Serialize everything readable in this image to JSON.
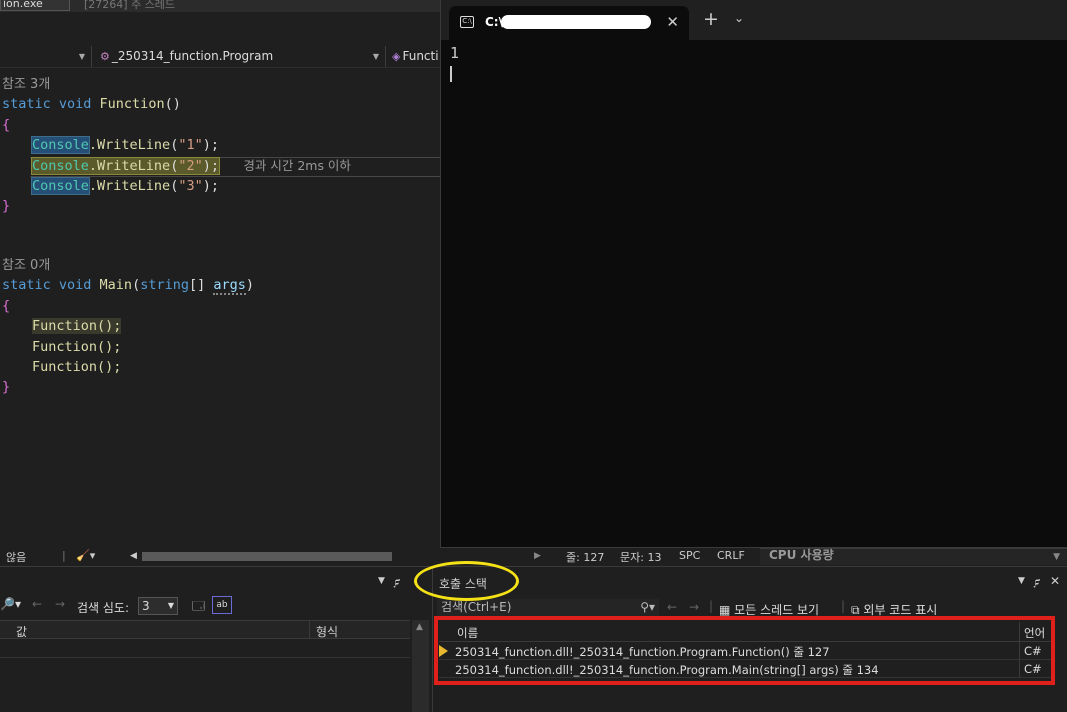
{
  "debug_bar": {
    "process_fragment": "ion.exe",
    "thread_fragment": "[27264] 주 스레드"
  },
  "nav": {
    "class_dropdown": "_250314_function.Program",
    "member_dropdown": "Functi"
  },
  "editor": {
    "ref_count_3": "참조 3개",
    "ref_count_0": "참조 0개",
    "elapsed_tip": "경과 시간 2ms 이하",
    "fn_decl": {
      "kw": "static void",
      "name": "Function",
      "params": "()"
    },
    "main_decl": {
      "kw": "static void",
      "name": "Main",
      "type": "string",
      "args": "args"
    },
    "writeline_calls": [
      {
        "cls": "Console",
        "method": ".WriteLine",
        "arg": "\"1\""
      },
      {
        "cls": "Console",
        "method": ".WriteLine",
        "arg": "\"2\""
      },
      {
        "cls": "Console",
        "method": ".WriteLine",
        "arg": "\"3\""
      }
    ],
    "function_calls": [
      "Function();",
      "Function();",
      "Function();"
    ]
  },
  "console": {
    "tab_title": "C:\\",
    "output_line": "1",
    "plus": "+",
    "chevron": "⌄",
    "close": "✕"
  },
  "status": {
    "issues": "않음",
    "line": "줄: 127",
    "char": "문자: 13",
    "spc": "SPC",
    "crlf": "CRLF",
    "cpu_panel": "CPU 사용량"
  },
  "watch_panel": {
    "search_depth_label": "검색 심도:",
    "search_depth_value": "3",
    "col_value": "값",
    "col_type": "형식"
  },
  "callstack": {
    "title": "호출 스택",
    "search_placeholder": "검색(Ctrl+E)",
    "show_all_threads": "모든 스레드 보기",
    "show_external_code": "외부 코드 표시",
    "col_name": "이름",
    "col_language": "언어",
    "frames": [
      {
        "name": "250314_function.dll!_250314_function.Program.Function() 줄 127",
        "language": "C#",
        "current": true
      },
      {
        "name": "250314_function.dll!_250314_function.Program.Main(string[] args) 줄 134",
        "language": "C#",
        "current": false
      }
    ]
  },
  "colors": {
    "annotation_circle": "#f5e216",
    "annotation_box": "#e0201a",
    "current_frame_arrow": "#e8b92e"
  }
}
